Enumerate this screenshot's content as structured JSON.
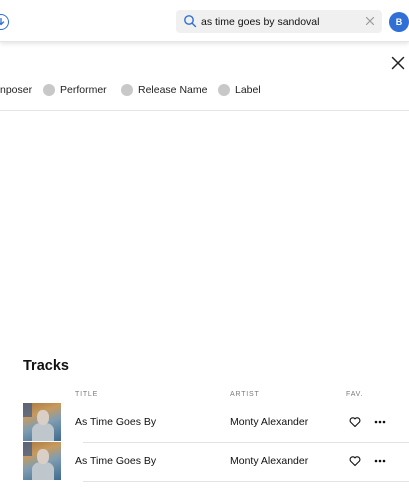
{
  "header": {
    "search": {
      "value": "as time goes by sandoval",
      "placeholder": ""
    },
    "avatar_initial": "B",
    "accent_color": "#2f6fd6"
  },
  "icons": {
    "download": "download-icon",
    "search": "search-icon",
    "clear": "clear-icon",
    "close": "close-icon",
    "favorite": "heart-icon",
    "more": "more-icon"
  },
  "filters": [
    {
      "label": "Composer",
      "visible_text": "nposer"
    },
    {
      "label": "Performer"
    },
    {
      "label": "Release Name"
    },
    {
      "label": "Label"
    }
  ],
  "tracks": {
    "title": "Tracks",
    "columns": {
      "title": "TITLE",
      "artist": "ARTIST",
      "fav": "FAV."
    },
    "rows": [
      {
        "title": "As Time Goes By",
        "artist": "Monty Alexander"
      },
      {
        "title": "As Time Goes By",
        "artist": "Monty Alexander"
      }
    ]
  }
}
